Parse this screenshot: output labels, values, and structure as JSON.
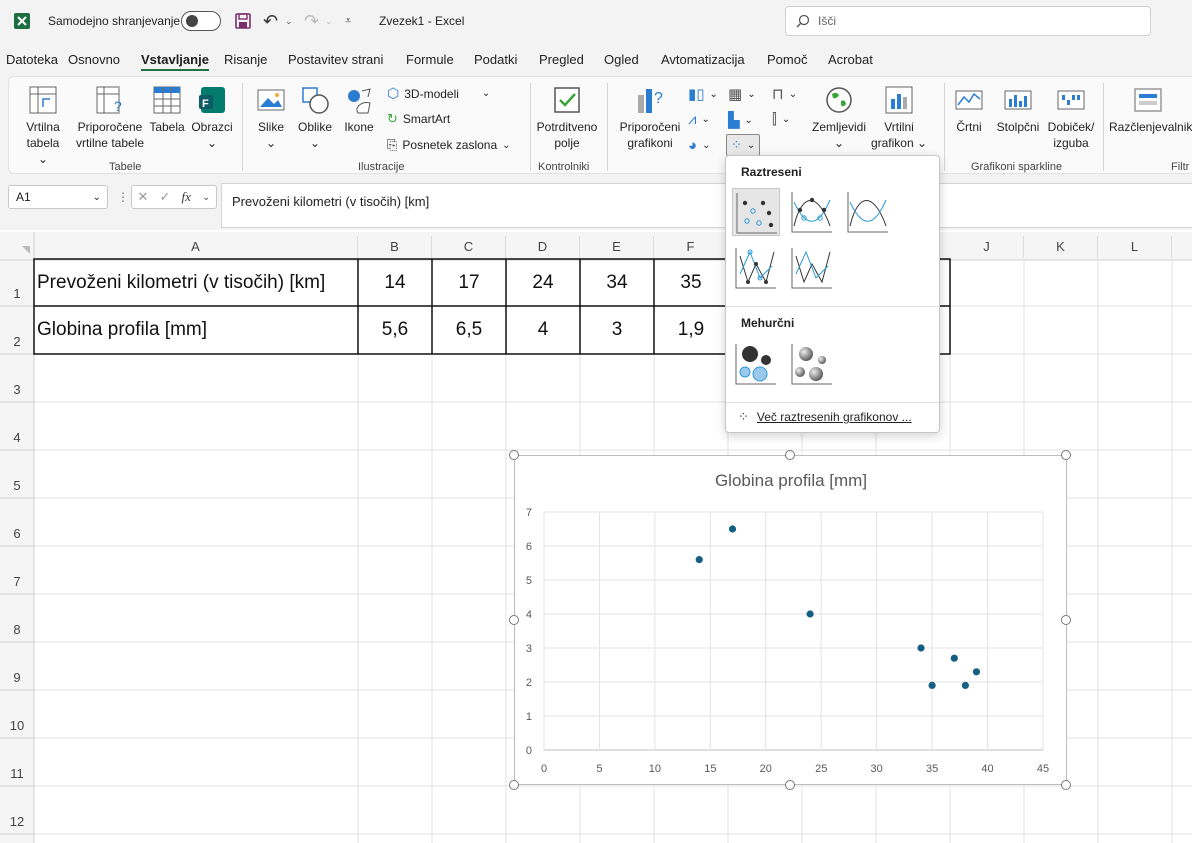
{
  "titlebar": {
    "autosave_label": "Samodejno shranjevanje",
    "doc_title": "Zvezek1",
    "separator": "-",
    "app_name": "Excel",
    "search_placeholder": "Išči"
  },
  "menu": {
    "items": [
      "Datoteka",
      "Osnovno",
      "Vstavljanje",
      "Risanje",
      "Postavitev strani",
      "Formule",
      "Podatki",
      "Pregled",
      "Ogled",
      "Avtomatizacija",
      "Pomoč",
      "Acrobat"
    ],
    "active": "Vstavljanje"
  },
  "ribbon": {
    "pivot_table": [
      "Vrtilna",
      "tabela"
    ],
    "recommended_pivot": [
      "Priporočene",
      "vrtilne tabele"
    ],
    "table": "Tabela",
    "forms": "Obrazci",
    "group_tables": "Tabele",
    "pictures": "Slike",
    "shapes": "Oblike",
    "icons": "Ikone",
    "models_3d": "3D-modeli",
    "smartart": "SmartArt",
    "screenshot": "Posnetek zaslona",
    "group_illustrations": "Ilustracije",
    "checkbox": [
      "Potrditveno",
      "polje"
    ],
    "group_controls": "Kontrolniki",
    "recommended_charts": [
      "Priporočeni",
      "grafikoni"
    ],
    "maps": "Zemljevidi",
    "pivot_chart": [
      "Vrtilni",
      "grafikon"
    ],
    "line_spark": "Črtni",
    "column_spark": "Stolpčni",
    "winloss": [
      "Dobiček/",
      "izguba"
    ],
    "group_sparklines": "Grafikoni sparkline",
    "slicer": "Razčlenjevalnik",
    "group_filters": "Filtr"
  },
  "formula_bar": {
    "name_box": "A1",
    "fx": "fx",
    "content": "Prevoženi kilometri (v tisočih) [km]"
  },
  "sheet": {
    "columns": [
      "A",
      "B",
      "C",
      "D",
      "E",
      "F",
      "J",
      "K",
      "L"
    ],
    "rows": [
      "1",
      "2",
      "3",
      "4",
      "5",
      "6",
      "7",
      "8",
      "9",
      "10",
      "11",
      "12"
    ],
    "row1": [
      "Prevoženi kilometri (v tisočih) [km]",
      "14",
      "17",
      "24",
      "34",
      "35"
    ],
    "row2": [
      "Globina profila [mm]",
      "5,6",
      "6,5",
      "4",
      "3",
      "1,9"
    ]
  },
  "dropdown": {
    "section_scatter": "Raztreseni",
    "section_bubble": "Mehurčni",
    "more_link": "Več raztresenih grafikonov ..."
  },
  "chart_data": {
    "type": "scatter",
    "title": "Globina profila [mm]",
    "xlim": [
      0,
      45
    ],
    "ylim": [
      0,
      7
    ],
    "x_ticks": [
      "0",
      "5",
      "10",
      "15",
      "20",
      "25",
      "30",
      "35",
      "40",
      "45"
    ],
    "y_ticks": [
      "0",
      "1",
      "2",
      "3",
      "4",
      "5",
      "6",
      "7"
    ],
    "grid": true,
    "color": "#156082",
    "points": [
      {
        "x": 14,
        "y": 5.6
      },
      {
        "x": 17,
        "y": 6.5
      },
      {
        "x": 24,
        "y": 4
      },
      {
        "x": 34,
        "y": 3
      },
      {
        "x": 35,
        "y": 1.9
      },
      {
        "x": 37,
        "y": 2.7
      },
      {
        "x": 38,
        "y": 1.9
      },
      {
        "x": 39,
        "y": 2.3
      }
    ]
  }
}
